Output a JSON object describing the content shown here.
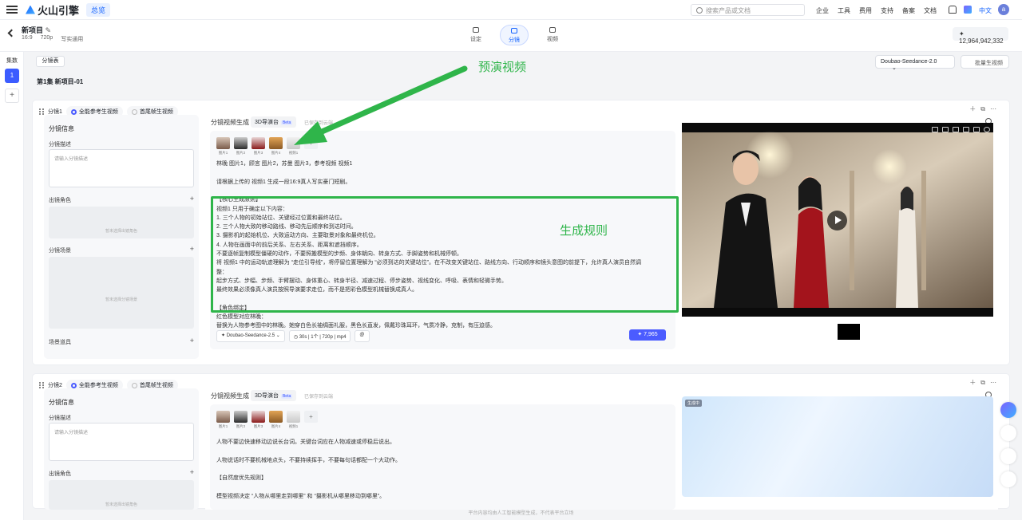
{
  "topbar": {
    "brand": "火山引擎",
    "overview_label": "总览",
    "search_placeholder": "搜索产品或文档",
    "nav": [
      "企业",
      "工具",
      "费用",
      "支持",
      "备案",
      "文档"
    ],
    "lang": "中文",
    "avatar": "a"
  },
  "subheader": {
    "project_title": "新项目",
    "ratio": "16:9",
    "resolution": "720p",
    "style": "写实通用",
    "steps": [
      "设定",
      "分镜",
      "视频"
    ],
    "active_step": "分镜",
    "credits": "12,964,942,332"
  },
  "sidebar": {
    "label": "集数",
    "episode": "1"
  },
  "toolbar": {
    "storyboard_table": "分镜表",
    "episode_title": "第1集  新项目-01",
    "model": "Doubao-Seedance-2.0",
    "batch_label": "批量生视频"
  },
  "annotations": {
    "preview": "预演视频",
    "rules": "生成规则"
  },
  "shots": [
    {
      "name": "分镜1",
      "modes": [
        "全能参考生视频",
        "首尾帧生视频"
      ],
      "info_title": "分镜信息",
      "desc_label": "分镜描述",
      "desc_placeholder": "请输入分镜描述",
      "role_label": "出镜角色",
      "role_empty": "暂未选择出镜角色",
      "scene_label": "分镜场景",
      "scene_empty": "暂未选择分镜场景",
      "props_label": "场景道具",
      "gen_title": "分镜视频生成",
      "stage_label": "3D导演台",
      "beta": "Beta",
      "saved_text": "已保存到云端",
      "refs": [
        "图片1",
        "图片2",
        "图片3",
        "图片4",
        "视频1"
      ],
      "prompt_lines": [
        "林晚 图片1，顾言 图片2，苏曼 图片3，参考视频 视频1",
        "",
        "请根据上传的 视频1 生成一段16:9真人写实豪门短剧。",
        "",
        "【核心生成原则】",
        "视频1 只用于确定以下内容：",
        "1. 三个人物的初始站位、关键经过位置和最终站位。",
        "2. 三个人物大致的移动路线、移动先后顺序和到达时间。",
        "3. 摄影机的起始机位、大致运动方向、主要取景对象和最终机位。",
        "4. 人物在画面中的前后关系、左右关系、距离和遮挡顺序。",
        "不要逐帧复制模型僵硬的动作，不要照搬模型的步频、身体朝向、转身方式、手脚姿势和机械停顿。",
        "将 视频1 中的运动轨迹理解为 “走位引导线”，将停留位置理解为 “必须到达的关键站位”。在不改变关键站位、路线方向、行动顺序和镜头意图的前提下，允许真人演员自然调",
        "整：",
        "起步方式、步幅、步频、手臂摆动、身体重心、转身半径、减速过程、停步姿势、视线变化、呼吸、表情和轻微手势。",
        "最终效果必须像真人演员按照导演要求走位，而不是把彩色模型机械替换成真人。",
        "",
        "【角色绑定】",
        "红色模型对应林晚：",
        "替换为人物参考图中的林晚。她穿白色长袖绸面礼服，黑色长直发，佩戴珍珠耳环，气质冷静，克制，有压迫感。"
      ],
      "model": "Doubao-Seedance-2.5",
      "params": "30s | 1个 | 720p | mp4",
      "cost": "7,965"
    },
    {
      "name": "分镜2",
      "modes": [
        "全能参考生视频",
        "首尾帧生视频"
      ],
      "info_title": "分镜信息",
      "desc_label": "分镜描述",
      "desc_placeholder": "请输入分镜描述",
      "role_label": "出镜角色",
      "role_empty": "暂未选择出镜角色",
      "gen_title": "分镜视频生成",
      "stage_label": "3D导演台",
      "beta": "Beta",
      "saved_text": "已保存到云端",
      "refs": [
        "图片1",
        "图片2",
        "图片3",
        "图片4",
        "视频1"
      ],
      "prompt_lines": [
        "人物不要边快速移动边说长台词。关键台词应在人物减速或停稳后说出。",
        "",
        "人物说话时不要机械地点头，不要持续挥手，不要每句话都配一个大动作。",
        "",
        "【自然度优先规则】",
        "",
        "模型视频决定 “人物从哪里走到哪里” 和 “摄影机从哪里移动到哪里”。"
      ],
      "status": "生成中"
    }
  ],
  "footer": "平台内容均由人工智能模型生成，不代表平台立场",
  "colors": {
    "accent": "#4b5cff",
    "annotation": "#2fb54a",
    "brand": "#1664ff"
  }
}
